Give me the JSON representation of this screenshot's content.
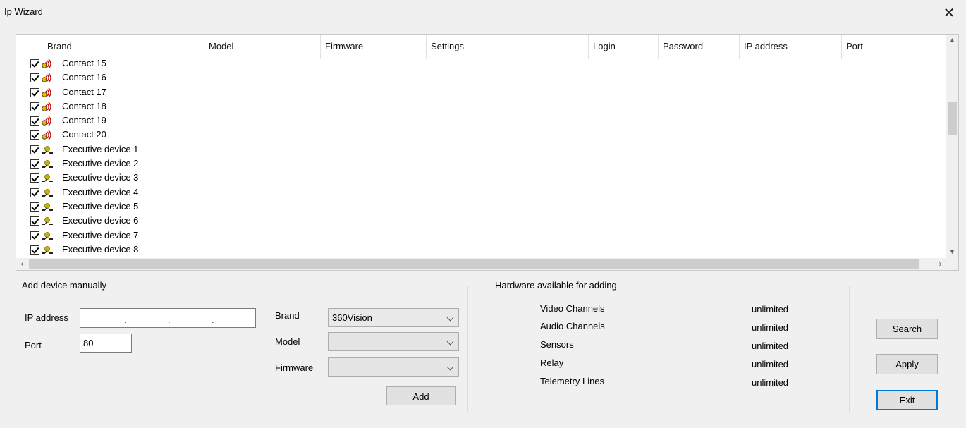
{
  "window": {
    "title": "Ip Wizard",
    "close_glyph": "✕"
  },
  "columns": [
    "Brand",
    "Model",
    "Firmware",
    "Settings",
    "Login",
    "Password",
    "IP address",
    "Port"
  ],
  "rows": [
    {
      "label": "Contact 15",
      "icon": "contact-sensor-icon"
    },
    {
      "label": "Contact 16",
      "icon": "contact-sensor-icon"
    },
    {
      "label": "Contact 17",
      "icon": "contact-sensor-icon"
    },
    {
      "label": "Contact 18",
      "icon": "contact-sensor-icon"
    },
    {
      "label": "Contact 19",
      "icon": "contact-sensor-icon"
    },
    {
      "label": "Contact 20",
      "icon": "contact-sensor-icon"
    },
    {
      "label": "Executive device 1",
      "icon": "executive-device-icon"
    },
    {
      "label": "Executive device 2",
      "icon": "executive-device-icon"
    },
    {
      "label": "Executive device 3",
      "icon": "executive-device-icon"
    },
    {
      "label": "Executive device 4",
      "icon": "executive-device-icon"
    },
    {
      "label": "Executive device 5",
      "icon": "executive-device-icon"
    },
    {
      "label": "Executive device 6",
      "icon": "executive-device-icon"
    },
    {
      "label": "Executive device 7",
      "icon": "executive-device-icon"
    },
    {
      "label": "Executive device 8",
      "icon": "executive-device-icon"
    }
  ],
  "add_device": {
    "title": "Add device manually",
    "ip_label": "IP address",
    "ip_value": "",
    "port_label": "Port",
    "port_value": "80",
    "brand_label": "Brand",
    "brand_value": "360Vision",
    "model_label": "Model",
    "model_value": "",
    "firmware_label": "Firmware",
    "firmware_value": "",
    "add_button": "Add"
  },
  "hardware": {
    "title": "Hardware available for adding",
    "items": [
      {
        "name": "Video Channels",
        "value": "unlimited"
      },
      {
        "name": "Audio Channels",
        "value": "unlimited"
      },
      {
        "name": "Sensors",
        "value": "unlimited"
      },
      {
        "name": "Relay",
        "value": "unlimited"
      },
      {
        "name": "Telemetry Lines",
        "value": "unlimited"
      }
    ]
  },
  "buttons": {
    "search": "Search",
    "apply": "Apply",
    "exit": "Exit"
  },
  "colors": {
    "accent": "#0078d7",
    "window_bg": "#f0f0f0"
  }
}
